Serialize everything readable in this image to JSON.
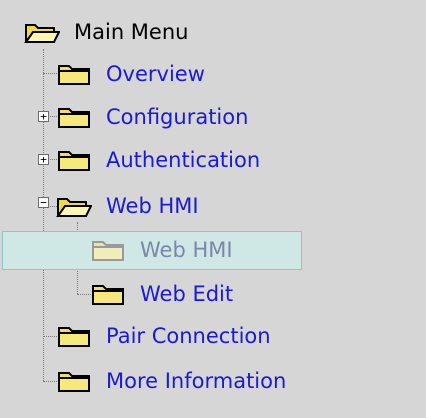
{
  "tree": {
    "root": {
      "label": "Main Menu",
      "icon": "open-folder-icon"
    },
    "items": [
      {
        "label": "Overview",
        "icon": "folder-icon"
      },
      {
        "label": "Configuration",
        "icon": "folder-icon",
        "expander": "+"
      },
      {
        "label": "Authentication",
        "icon": "folder-icon",
        "expander": "+"
      },
      {
        "label": "Web HMI",
        "icon": "open-folder-icon",
        "expander": "−"
      },
      {
        "label": "Web HMI",
        "icon": "folder-icon"
      },
      {
        "label": "Web Edit",
        "icon": "folder-icon"
      },
      {
        "label": "Pair Connection",
        "icon": "folder-icon"
      },
      {
        "label": "More Information",
        "icon": "folder-icon"
      }
    ]
  },
  "colors": {
    "background": "#d6d6d6",
    "link": "#1a1ad6",
    "selected_text": "#7b86a8",
    "highlight": "#cfe8e6",
    "folder": "#f2de5a"
  }
}
